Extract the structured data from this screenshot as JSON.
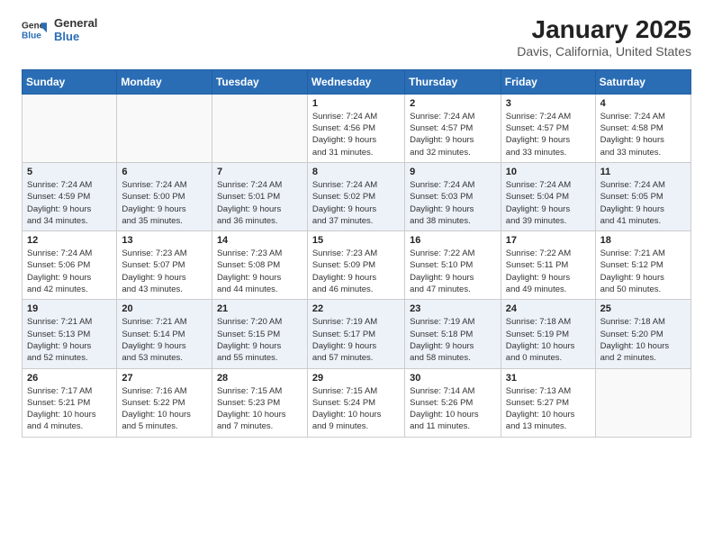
{
  "logo": {
    "general": "General",
    "blue": "Blue"
  },
  "title": "January 2025",
  "subtitle": "Davis, California, United States",
  "days_of_week": [
    "Sunday",
    "Monday",
    "Tuesday",
    "Wednesday",
    "Thursday",
    "Friday",
    "Saturday"
  ],
  "weeks": [
    [
      {
        "day": "",
        "info": ""
      },
      {
        "day": "",
        "info": ""
      },
      {
        "day": "",
        "info": ""
      },
      {
        "day": "1",
        "info": "Sunrise: 7:24 AM\nSunset: 4:56 PM\nDaylight: 9 hours\nand 31 minutes."
      },
      {
        "day": "2",
        "info": "Sunrise: 7:24 AM\nSunset: 4:57 PM\nDaylight: 9 hours\nand 32 minutes."
      },
      {
        "day": "3",
        "info": "Sunrise: 7:24 AM\nSunset: 4:57 PM\nDaylight: 9 hours\nand 33 minutes."
      },
      {
        "day": "4",
        "info": "Sunrise: 7:24 AM\nSunset: 4:58 PM\nDaylight: 9 hours\nand 33 minutes."
      }
    ],
    [
      {
        "day": "5",
        "info": "Sunrise: 7:24 AM\nSunset: 4:59 PM\nDaylight: 9 hours\nand 34 minutes."
      },
      {
        "day": "6",
        "info": "Sunrise: 7:24 AM\nSunset: 5:00 PM\nDaylight: 9 hours\nand 35 minutes."
      },
      {
        "day": "7",
        "info": "Sunrise: 7:24 AM\nSunset: 5:01 PM\nDaylight: 9 hours\nand 36 minutes."
      },
      {
        "day": "8",
        "info": "Sunrise: 7:24 AM\nSunset: 5:02 PM\nDaylight: 9 hours\nand 37 minutes."
      },
      {
        "day": "9",
        "info": "Sunrise: 7:24 AM\nSunset: 5:03 PM\nDaylight: 9 hours\nand 38 minutes."
      },
      {
        "day": "10",
        "info": "Sunrise: 7:24 AM\nSunset: 5:04 PM\nDaylight: 9 hours\nand 39 minutes."
      },
      {
        "day": "11",
        "info": "Sunrise: 7:24 AM\nSunset: 5:05 PM\nDaylight: 9 hours\nand 41 minutes."
      }
    ],
    [
      {
        "day": "12",
        "info": "Sunrise: 7:24 AM\nSunset: 5:06 PM\nDaylight: 9 hours\nand 42 minutes."
      },
      {
        "day": "13",
        "info": "Sunrise: 7:23 AM\nSunset: 5:07 PM\nDaylight: 9 hours\nand 43 minutes."
      },
      {
        "day": "14",
        "info": "Sunrise: 7:23 AM\nSunset: 5:08 PM\nDaylight: 9 hours\nand 44 minutes."
      },
      {
        "day": "15",
        "info": "Sunrise: 7:23 AM\nSunset: 5:09 PM\nDaylight: 9 hours\nand 46 minutes."
      },
      {
        "day": "16",
        "info": "Sunrise: 7:22 AM\nSunset: 5:10 PM\nDaylight: 9 hours\nand 47 minutes."
      },
      {
        "day": "17",
        "info": "Sunrise: 7:22 AM\nSunset: 5:11 PM\nDaylight: 9 hours\nand 49 minutes."
      },
      {
        "day": "18",
        "info": "Sunrise: 7:21 AM\nSunset: 5:12 PM\nDaylight: 9 hours\nand 50 minutes."
      }
    ],
    [
      {
        "day": "19",
        "info": "Sunrise: 7:21 AM\nSunset: 5:13 PM\nDaylight: 9 hours\nand 52 minutes."
      },
      {
        "day": "20",
        "info": "Sunrise: 7:21 AM\nSunset: 5:14 PM\nDaylight: 9 hours\nand 53 minutes."
      },
      {
        "day": "21",
        "info": "Sunrise: 7:20 AM\nSunset: 5:15 PM\nDaylight: 9 hours\nand 55 minutes."
      },
      {
        "day": "22",
        "info": "Sunrise: 7:19 AM\nSunset: 5:17 PM\nDaylight: 9 hours\nand 57 minutes."
      },
      {
        "day": "23",
        "info": "Sunrise: 7:19 AM\nSunset: 5:18 PM\nDaylight: 9 hours\nand 58 minutes."
      },
      {
        "day": "24",
        "info": "Sunrise: 7:18 AM\nSunset: 5:19 PM\nDaylight: 10 hours\nand 0 minutes."
      },
      {
        "day": "25",
        "info": "Sunrise: 7:18 AM\nSunset: 5:20 PM\nDaylight: 10 hours\nand 2 minutes."
      }
    ],
    [
      {
        "day": "26",
        "info": "Sunrise: 7:17 AM\nSunset: 5:21 PM\nDaylight: 10 hours\nand 4 minutes."
      },
      {
        "day": "27",
        "info": "Sunrise: 7:16 AM\nSunset: 5:22 PM\nDaylight: 10 hours\nand 5 minutes."
      },
      {
        "day": "28",
        "info": "Sunrise: 7:15 AM\nSunset: 5:23 PM\nDaylight: 10 hours\nand 7 minutes."
      },
      {
        "day": "29",
        "info": "Sunrise: 7:15 AM\nSunset: 5:24 PM\nDaylight: 10 hours\nand 9 minutes."
      },
      {
        "day": "30",
        "info": "Sunrise: 7:14 AM\nSunset: 5:26 PM\nDaylight: 10 hours\nand 11 minutes."
      },
      {
        "day": "31",
        "info": "Sunrise: 7:13 AM\nSunset: 5:27 PM\nDaylight: 10 hours\nand 13 minutes."
      },
      {
        "day": "",
        "info": ""
      }
    ]
  ]
}
